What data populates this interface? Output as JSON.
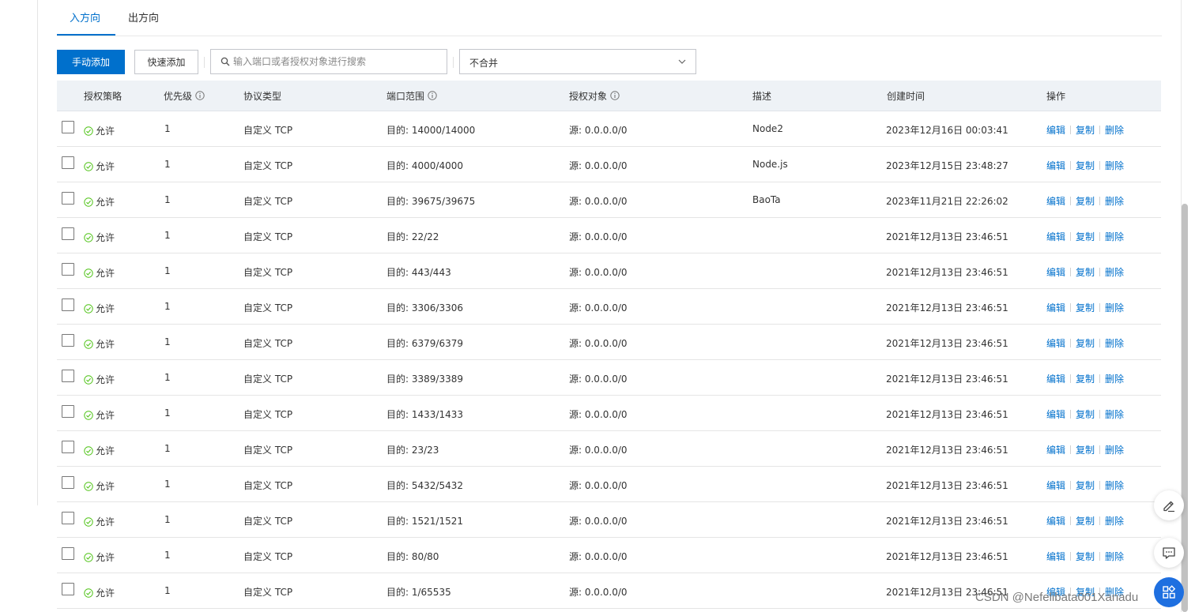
{
  "tabs": [
    {
      "label": "入方向"
    },
    {
      "label": "出方向"
    }
  ],
  "toolbar": {
    "manual_add": "手动添加",
    "quick_add": "快速添加",
    "search_placeholder": "输入端口或者授权对象进行搜索",
    "merge_select": "不合并"
  },
  "columns": {
    "policy": "授权策略",
    "priority": "优先级",
    "protocol": "协议类型",
    "port_range": "端口范围",
    "source": "授权对象",
    "description": "描述",
    "created": "创建时间",
    "actions": "操作"
  },
  "actions": {
    "edit": "编辑",
    "copy": "复制",
    "delete": "删除"
  },
  "rows": [
    {
      "policy": "允许",
      "priority": "1",
      "protocol": "自定义 TCP",
      "port": "目的: 14000/14000",
      "source": "源: 0.0.0.0/0",
      "desc": "Node2",
      "time": "2023年12月16日 00:03:41"
    },
    {
      "policy": "允许",
      "priority": "1",
      "protocol": "自定义 TCP",
      "port": "目的: 4000/4000",
      "source": "源: 0.0.0.0/0",
      "desc": "Node.js",
      "time": "2023年12月15日 23:48:27"
    },
    {
      "policy": "允许",
      "priority": "1",
      "protocol": "自定义 TCP",
      "port": "目的: 39675/39675",
      "source": "源: 0.0.0.0/0",
      "desc": "BaoTa",
      "time": "2023年11月21日 22:26:02"
    },
    {
      "policy": "允许",
      "priority": "1",
      "protocol": "自定义 TCP",
      "port": "目的: 22/22",
      "source": "源: 0.0.0.0/0",
      "desc": "",
      "time": "2021年12月13日 23:46:51"
    },
    {
      "policy": "允许",
      "priority": "1",
      "protocol": "自定义 TCP",
      "port": "目的: 443/443",
      "source": "源: 0.0.0.0/0",
      "desc": "",
      "time": "2021年12月13日 23:46:51"
    },
    {
      "policy": "允许",
      "priority": "1",
      "protocol": "自定义 TCP",
      "port": "目的: 3306/3306",
      "source": "源: 0.0.0.0/0",
      "desc": "",
      "time": "2021年12月13日 23:46:51"
    },
    {
      "policy": "允许",
      "priority": "1",
      "protocol": "自定义 TCP",
      "port": "目的: 6379/6379",
      "source": "源: 0.0.0.0/0",
      "desc": "",
      "time": "2021年12月13日 23:46:51"
    },
    {
      "policy": "允许",
      "priority": "1",
      "protocol": "自定义 TCP",
      "port": "目的: 3389/3389",
      "source": "源: 0.0.0.0/0",
      "desc": "",
      "time": "2021年12月13日 23:46:51"
    },
    {
      "policy": "允许",
      "priority": "1",
      "protocol": "自定义 TCP",
      "port": "目的: 1433/1433",
      "source": "源: 0.0.0.0/0",
      "desc": "",
      "time": "2021年12月13日 23:46:51"
    },
    {
      "policy": "允许",
      "priority": "1",
      "protocol": "自定义 TCP",
      "port": "目的: 23/23",
      "source": "源: 0.0.0.0/0",
      "desc": "",
      "time": "2021年12月13日 23:46:51"
    },
    {
      "policy": "允许",
      "priority": "1",
      "protocol": "自定义 TCP",
      "port": "目的: 5432/5432",
      "source": "源: 0.0.0.0/0",
      "desc": "",
      "time": "2021年12月13日 23:46:51"
    },
    {
      "policy": "允许",
      "priority": "1",
      "protocol": "自定义 TCP",
      "port": "目的: 1521/1521",
      "source": "源: 0.0.0.0/0",
      "desc": "",
      "time": "2021年12月13日 23:46:51"
    },
    {
      "policy": "允许",
      "priority": "1",
      "protocol": "自定义 TCP",
      "port": "目的: 80/80",
      "source": "源: 0.0.0.0/0",
      "desc": "",
      "time": "2021年12月13日 23:46:51"
    },
    {
      "policy": "允许",
      "priority": "1",
      "protocol": "自定义 TCP",
      "port": "目的: 1/65535",
      "source": "源: 0.0.0.0/0",
      "desc": "",
      "time": "2021年12月13日 23:46:51"
    }
  ],
  "watermark": "CSDN @Nefelibata001Xanadu",
  "colors": {
    "primary": "#0070cc",
    "success": "#52c41a",
    "header_bg": "#eef2f6"
  }
}
